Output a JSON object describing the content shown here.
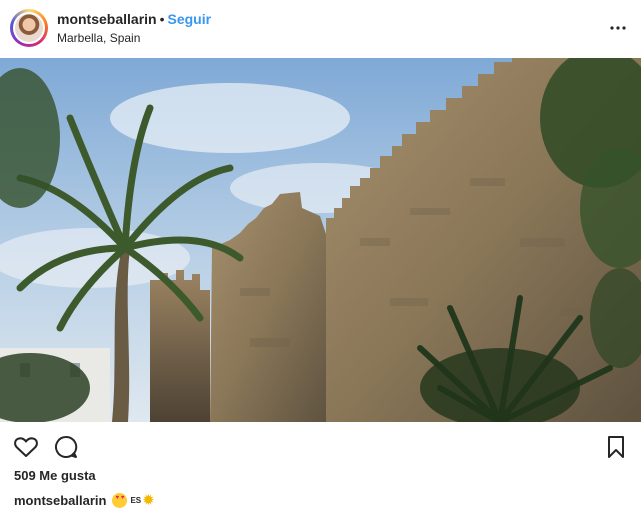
{
  "post": {
    "username": "montseballarin",
    "separator": "•",
    "follow_label": "Seguir",
    "location": "Marbella, Spain",
    "likes_text": "509 Me gusta",
    "caption": {
      "username": "montseballarin",
      "emoji_1": "smiling-face-with-heart-eyes",
      "text": "ES",
      "emoji_2": "sun"
    },
    "image_subject": "palm tree and medieval castle wall with crenellations under blue sky"
  },
  "icons": {
    "more": "more-horizontal-icon",
    "like": "heart-outline-icon",
    "comment": "comment-bubble-icon",
    "save": "bookmark-outline-icon"
  },
  "colors": {
    "follow": "#3897f0",
    "text": "#262626",
    "background": "#ffffff"
  }
}
